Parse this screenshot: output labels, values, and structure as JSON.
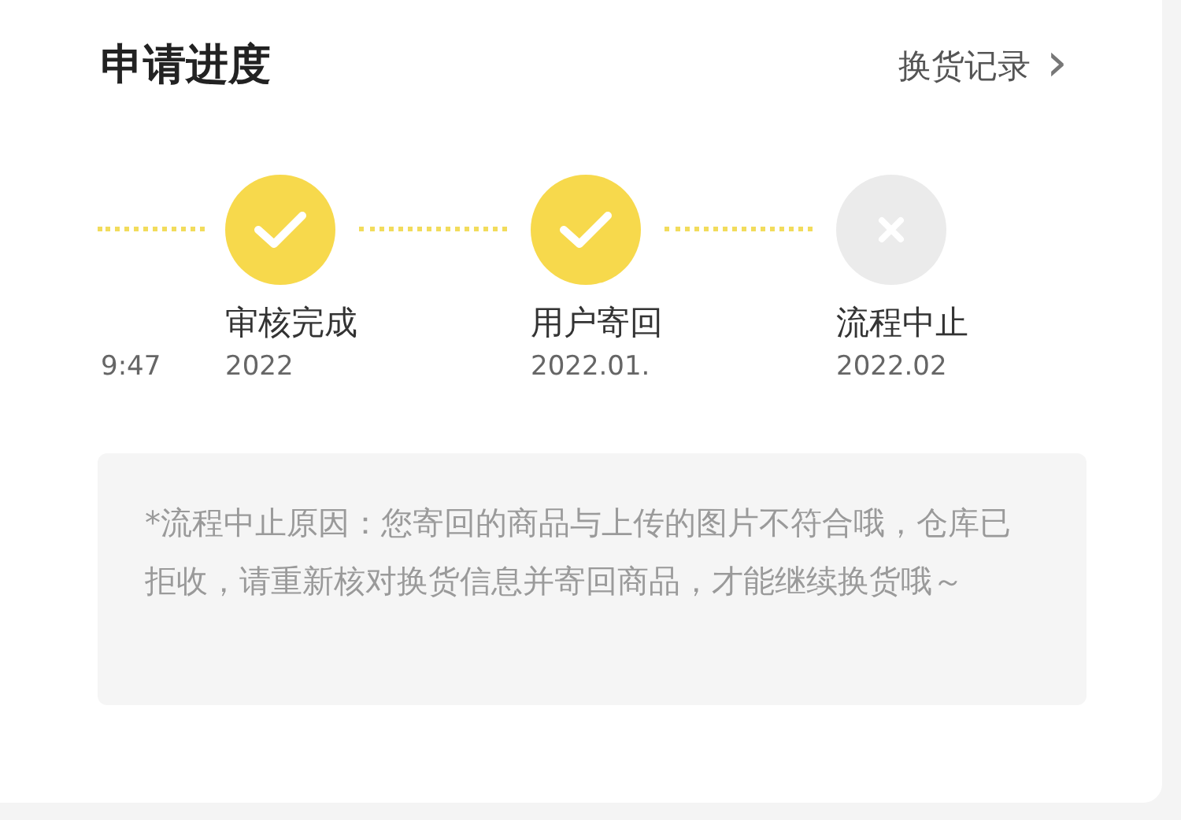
{
  "title": "申请进度",
  "history_link": {
    "label": "换货记录",
    "icon": "›"
  },
  "earlier_step": {
    "date": "9:47"
  },
  "steps": [
    {
      "kind": "done",
      "label": "审核完成",
      "date": "2022"
    },
    {
      "kind": "done",
      "label": "用户寄回",
      "date": "2022.01."
    },
    {
      "kind": "stopped",
      "label": "流程中止",
      "date": "2022.02"
    }
  ],
  "notice": "*流程中止原因：您寄回的商品与上传的图片不符合哦，仓库已拒收，请重新核对换货信息并寄回商品，才能继续换货哦～"
}
